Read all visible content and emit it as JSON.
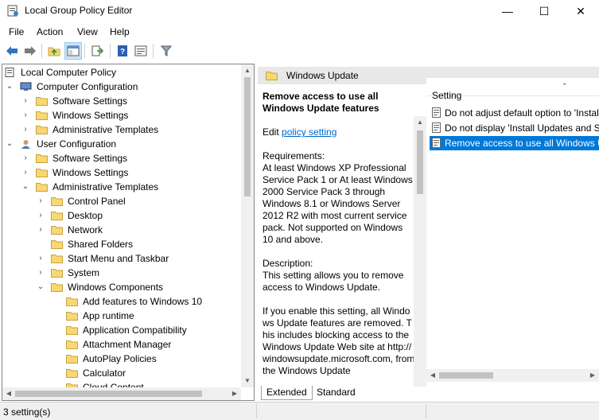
{
  "window": {
    "title": "Local Group Policy Editor",
    "minimize_glyph": "—",
    "maximize_glyph": "☐",
    "close_glyph": "✕"
  },
  "menu": [
    "File",
    "Action",
    "View",
    "Help"
  ],
  "toolbar": {
    "icons": [
      "back-arrow-icon",
      "forward-arrow-icon",
      "up-folder-icon",
      "show-hide-tree-icon",
      "export-list-icon",
      "help-icon",
      "properties-icon",
      "filter-icon"
    ]
  },
  "tree": {
    "items": [
      {
        "label": "Local Computer Policy",
        "icon": "policy-icon",
        "expander": ""
      },
      {
        "label": "Computer Configuration",
        "icon": "computer-icon",
        "expander": "⌄"
      },
      {
        "label": "Software Settings",
        "icon": "folder-icon",
        "expander": "›"
      },
      {
        "label": "Windows Settings",
        "icon": "folder-icon",
        "expander": "›"
      },
      {
        "label": "Administrative Templates",
        "icon": "folder-icon",
        "expander": "›"
      },
      {
        "label": "User Configuration",
        "icon": "user-icon",
        "expander": "⌄"
      },
      {
        "label": "Software Settings",
        "icon": "folder-icon",
        "expander": "›"
      },
      {
        "label": "Windows Settings",
        "icon": "folder-icon",
        "expander": "›"
      },
      {
        "label": "Administrative Templates",
        "icon": "folder-icon",
        "expander": "⌄"
      },
      {
        "label": "Control Panel",
        "icon": "folder-icon",
        "expander": "›"
      },
      {
        "label": "Desktop",
        "icon": "folder-icon",
        "expander": "›"
      },
      {
        "label": "Network",
        "icon": "folder-icon",
        "expander": "›"
      },
      {
        "label": "Shared Folders",
        "icon": "folder-icon",
        "expander": ""
      },
      {
        "label": "Start Menu and Taskbar",
        "icon": "folder-icon",
        "expander": "›"
      },
      {
        "label": "System",
        "icon": "folder-icon",
        "expander": "›"
      },
      {
        "label": "Windows Components",
        "icon": "folder-icon",
        "expander": "⌄"
      },
      {
        "label": "Add features to Windows 10",
        "icon": "folder-icon",
        "expander": ""
      },
      {
        "label": "App runtime",
        "icon": "folder-icon",
        "expander": ""
      },
      {
        "label": "Application Compatibility",
        "icon": "folder-icon",
        "expander": ""
      },
      {
        "label": "Attachment Manager",
        "icon": "folder-icon",
        "expander": ""
      },
      {
        "label": "AutoPlay Policies",
        "icon": "folder-icon",
        "expander": ""
      },
      {
        "label": "Calculator",
        "icon": "folder-icon",
        "expander": ""
      },
      {
        "label": "Cloud Content",
        "icon": "folder-icon",
        "expander": ""
      }
    ]
  },
  "right_pane": {
    "header": "Windows Update",
    "description": {
      "title": "Remove access to use all Windows Update features",
      "edit_prefix": "Edit ",
      "edit_link": "policy setting",
      "requirements_label": "Requirements:",
      "requirements_text": "At least Windows XP Professional Service Pack 1 or At least Windows 2000 Service Pack 3 through Windows 8.1 or Windows Server 2012 R2 with most current service pack. Not supported on Windows 10 and above.",
      "description_label": "Description:",
      "description_text": "This setting allows you to remove access to Windows Update.",
      "enable_text": "If you enable this setting, all Windows Update features are removed. This includes blocking access to the Windows Update Web site at http://windowsupdate.microsoft.com, from the Windows Update"
    },
    "list": {
      "column_header": "Setting",
      "sort_glyph": "⌃",
      "rows": [
        {
          "label": "Do not adjust default option to 'Install Updates and Shut Down' in Shut Down Windows dialog box",
          "selected": false
        },
        {
          "label": "Do not display 'Install Updates and Shut Down' option in Shut Down Windows dialog box",
          "selected": false
        },
        {
          "label": "Remove access to use all Windows Update features",
          "selected": true
        }
      ]
    },
    "tabs": [
      "Extended",
      "Standard"
    ],
    "active_tab": "Extended"
  },
  "status": {
    "text": "3 setting(s)"
  },
  "colors": {
    "selection": "#0078d7",
    "folder": "#f8d775",
    "link": "#0066cc"
  }
}
